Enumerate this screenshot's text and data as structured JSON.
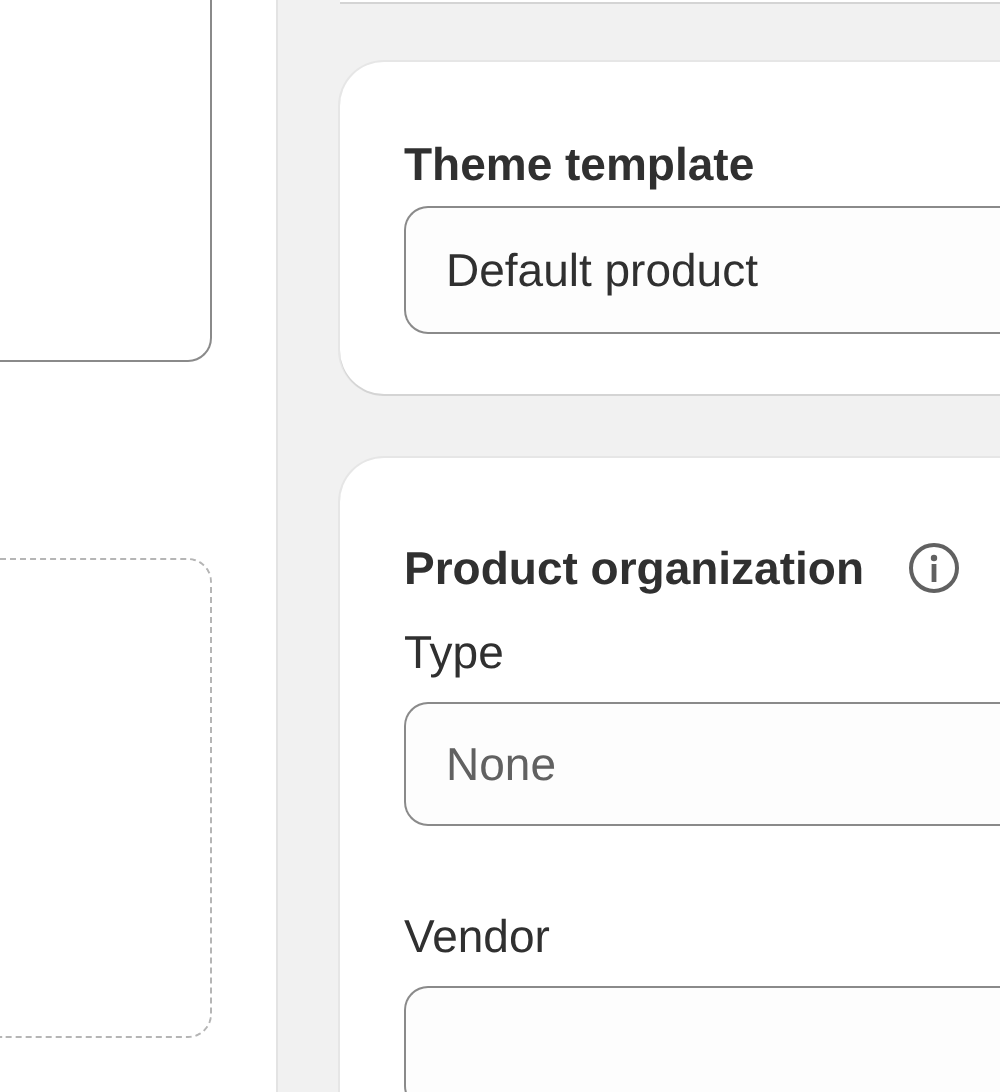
{
  "theme_template": {
    "title": "Theme template",
    "value": "Default product"
  },
  "product_organization": {
    "title": "Product organization",
    "fields": [
      {
        "label": "Type",
        "placeholder": "None"
      },
      {
        "label": "Vendor"
      }
    ]
  }
}
